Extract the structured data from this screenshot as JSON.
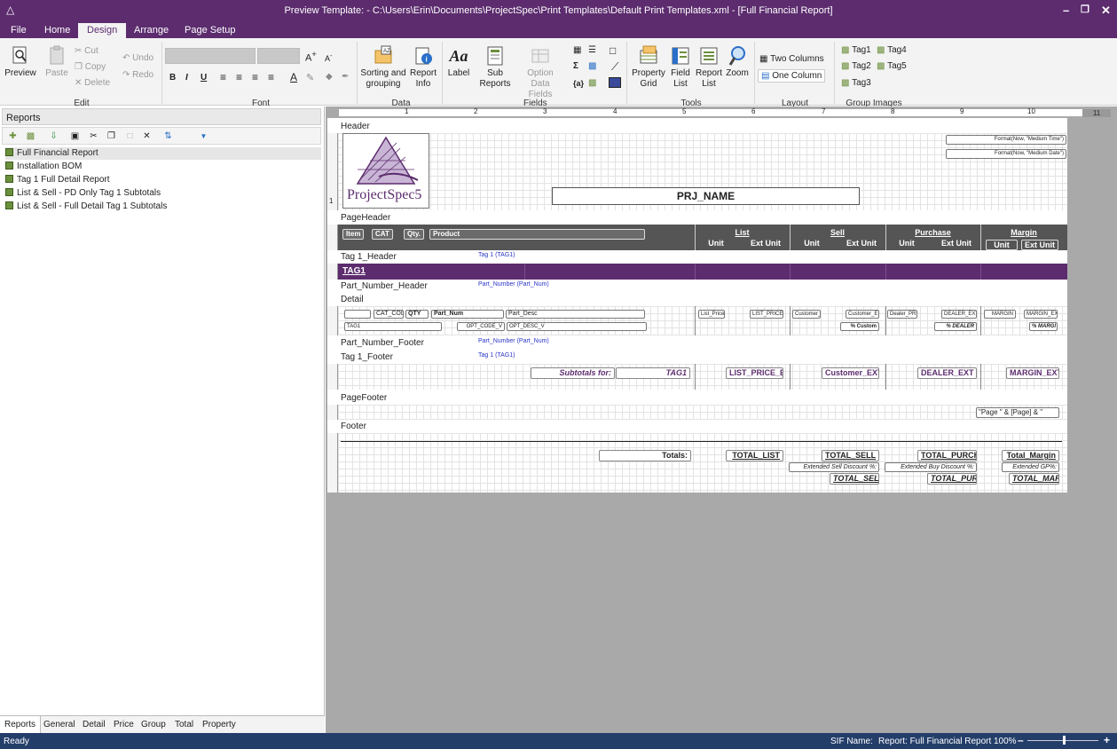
{
  "window": {
    "title": "Preview Template: - C:\\Users\\Erin\\Documents\\ProjectSpec\\Print Templates\\Default Print Templates.xml - [Full Financial Report]"
  },
  "ribbon_tabs": [
    "File",
    "Home",
    "Design",
    "Arrange",
    "Page Setup"
  ],
  "ribbon": {
    "preview": "Preview",
    "paste": "Paste",
    "cut": "Cut",
    "copy": "Copy",
    "delete": "Delete",
    "undo": "Undo",
    "redo": "Redo",
    "sorting": [
      "Sorting and",
      "grouping"
    ],
    "report_info": [
      "Report",
      "Info"
    ],
    "label": "Label",
    "sub_reports": [
      "Sub",
      "Reports"
    ],
    "option_data_fields": [
      "Option",
      "Data Fields"
    ],
    "property_grid": [
      "Property",
      "Grid"
    ],
    "field_list": [
      "Field",
      "List"
    ],
    "report_list": [
      "Report",
      "List"
    ],
    "zoom": "Zoom",
    "two_columns": "Two Columns",
    "one_column": "One Column",
    "tags": [
      "Tag1",
      "Tag4",
      "Tag2",
      "Tag5",
      "Tag3"
    ],
    "groups": {
      "edit": "Edit",
      "font": "Font",
      "data": "Data",
      "fields": "Fields",
      "tools": "Tools",
      "layout": "Layout",
      "group_images": "Group Images"
    }
  },
  "left_panel": {
    "title": "Reports",
    "reports": [
      "Full Financial Report",
      "Installation BOM",
      "Tag 1 Full Detail Report",
      "List & Sell - PD Only Tag 1 Subtotals",
      "List & Sell - Full Detail Tag 1 Subtotals"
    ],
    "bottom_tabs": [
      "Reports",
      "General",
      "Detail",
      "Price",
      "Group",
      "Total",
      "Property"
    ]
  },
  "ruler": [
    "1",
    "2",
    "3",
    "4",
    "5",
    "6",
    "7",
    "8",
    "9",
    "10",
    "11"
  ],
  "report": {
    "bands": {
      "header": "Header",
      "page_header": "PageHeader",
      "tag_header": "Tag 1_Header",
      "part_header": "Part_Number_Header",
      "detail": "Detail",
      "part_footer": "Part_Number_Footer",
      "tag_footer": "Tag 1_Footer",
      "page_footer": "PageFooter",
      "footer": "Footer"
    },
    "logo_text": "ProjectSpec5",
    "time_field": "Format(Now, \"Medium Time\")",
    "date_field": "Format(Now, \"Medium Date\")",
    "proj_name": "PRJ_NAME",
    "ruler_marker": "1",
    "page_header_cols": {
      "pills": [
        "Item",
        "CAT",
        "Qty.",
        "Product"
      ],
      "groups": [
        "List",
        "Sell",
        "Purchase",
        "Margin"
      ],
      "unit": "Unit",
      "ext_unit": "Ext Unit"
    },
    "tag_group_label": "Tag 1 (TAG1)",
    "tag1": "TAG1",
    "part_group_label": "Part_Number (Part_Num)",
    "detail_fields_row1": [
      "CAT_CODE",
      "QTY",
      "Part_Num",
      "Part_Desc",
      "List_Price",
      "LIST_PRICE_",
      "Customer_",
      "Customer_E",
      "Dealer_PRI",
      "DEALER_EXT",
      "MARGIN",
      "MARGIN_EX"
    ],
    "detail_fields_row2": [
      "TAG1",
      "OPT_CODE_V",
      "OPT_DESC_V",
      "% Custom",
      "% DEALER",
      "% MARGI"
    ],
    "tag_footer_fields": [
      "Subtotals for:",
      "TAG1",
      "LIST_PRICE_EX",
      "Customer_EXT",
      "DEALER_EXT",
      "MARGIN_EXT"
    ],
    "page_footer_field": "\"Page \" & [Page] & \"",
    "footer_fields": {
      "totals": "Totals:",
      "total_list": "TOTAL_LIST",
      "total_sell": "TOTAL_SELL",
      "total_purch": "TOTAL_PURCH",
      "total_margin": "Total_Margin",
      "ext_sell": "Extended Sell Discount %:",
      "ext_buy": "Extended Buy Discount %:",
      "ext_gp": "Extended GP%:",
      "total_sell2": "TOTAL_SELL",
      "total_pur2": "TOTAL_PUR",
      "total_mar2": "TOTAL_MAR"
    }
  },
  "status": {
    "left": "Ready",
    "sif": "SIF Name:",
    "report": "Report: Full Financial Report",
    "zoom": "100%"
  },
  "colors": {
    "accent": "#5c2c6e",
    "status": "#243e6a"
  }
}
